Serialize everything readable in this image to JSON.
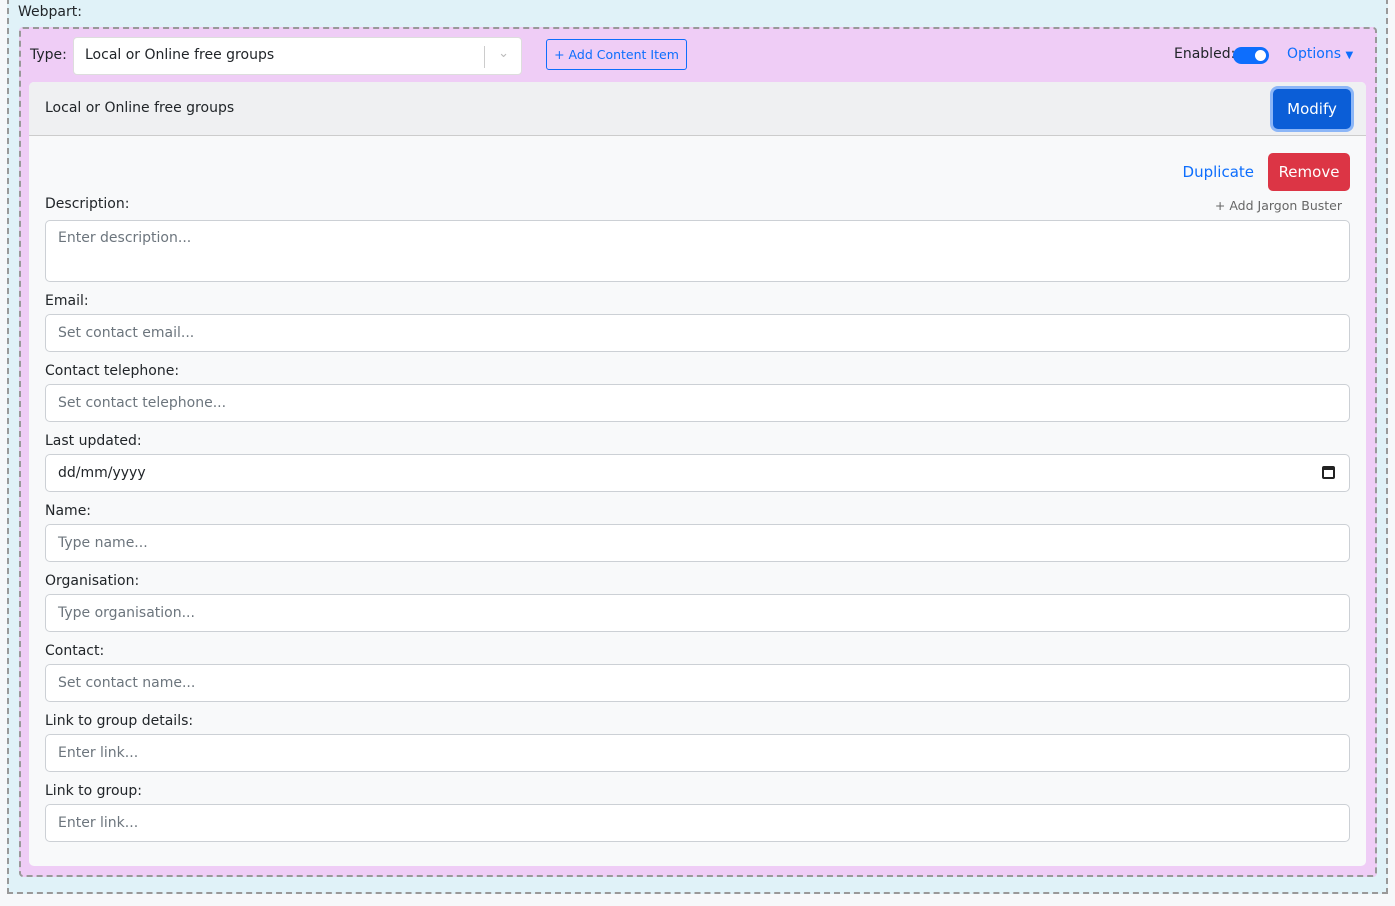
{
  "webpart_label": "Webpart:",
  "type_label": "Type:",
  "type_value": "Local or Online free groups",
  "add_content_item": "+ Add Content Item",
  "enabled_label": "Enabled:",
  "enabled": true,
  "options_label": "Options",
  "card_title": "Local or Online free groups",
  "modify": "Modify",
  "duplicate": "Duplicate",
  "remove": "Remove",
  "add_jargon": "+ Add Jargon Buster",
  "fields": [
    {
      "label": "Description:",
      "placeholder": "Enter description..."
    },
    {
      "label": "Email:",
      "placeholder": "Set contact email..."
    },
    {
      "label": "Contact telephone:",
      "placeholder": "Set contact telephone..."
    },
    {
      "label": "Last updated:",
      "value": "dd/mm/yyyy"
    },
    {
      "label": "Name:",
      "placeholder": "Type name..."
    },
    {
      "label": "Organisation:",
      "placeholder": "Type organisation..."
    },
    {
      "label": "Contact:",
      "placeholder": "Set contact name..."
    },
    {
      "label": "Link to group details:",
      "placeholder": "Enter link..."
    },
    {
      "label": "Link to group:",
      "placeholder": "Enter link..."
    }
  ]
}
